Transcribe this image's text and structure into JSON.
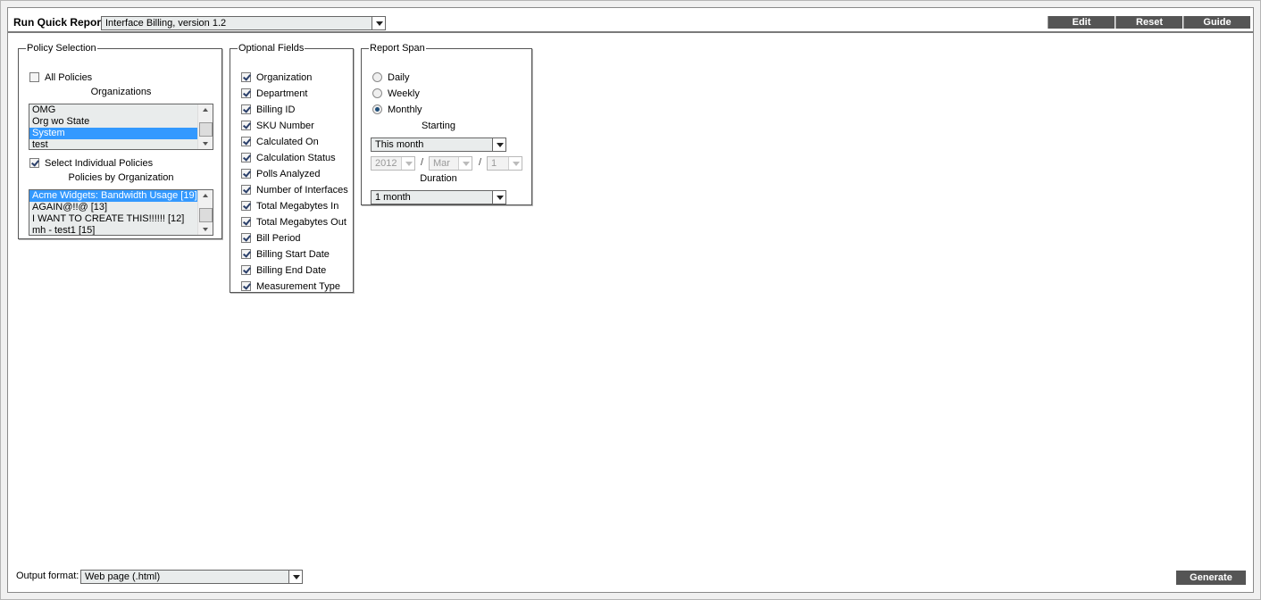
{
  "header": {
    "title": "Run Quick Report",
    "report_select": "Interface Billing, version 1.2",
    "buttons": {
      "edit": "Edit",
      "reset": "Reset",
      "guide": "Guide"
    }
  },
  "policy_selection": {
    "legend": "Policy Selection",
    "all_policies": {
      "label": "All Policies",
      "checked": false
    },
    "organizations_heading": "Organizations",
    "organizations": [
      {
        "label": "OMG",
        "selected": false
      },
      {
        "label": "Org wo State",
        "selected": false
      },
      {
        "label": "System",
        "selected": true
      },
      {
        "label": "test",
        "selected": false
      }
    ],
    "select_individual": {
      "label": "Select Individual Policies",
      "checked": true
    },
    "policies_heading": "Policies by Organization",
    "policies": [
      {
        "label": "Acme Widgets: Bandwidth Usage [19]",
        "selected": true
      },
      {
        "label": "AGAIN@!!@ [13]",
        "selected": false
      },
      {
        "label": "I WANT TO CREATE THIS!!!!!! [12]",
        "selected": false
      },
      {
        "label": "mh - test1 [15]",
        "selected": false
      }
    ]
  },
  "optional_fields": {
    "legend": "Optional Fields",
    "items": [
      {
        "label": "Organization",
        "checked": true
      },
      {
        "label": "Department",
        "checked": true
      },
      {
        "label": "Billing ID",
        "checked": true
      },
      {
        "label": "SKU Number",
        "checked": true
      },
      {
        "label": "Calculated On",
        "checked": true
      },
      {
        "label": "Calculation Status",
        "checked": true
      },
      {
        "label": "Polls Analyzed",
        "checked": true
      },
      {
        "label": "Number of Interfaces",
        "checked": true
      },
      {
        "label": "Total Megabytes In",
        "checked": true
      },
      {
        "label": "Total Megabytes Out",
        "checked": true
      },
      {
        "label": "Bill Period",
        "checked": true
      },
      {
        "label": "Billing Start Date",
        "checked": true
      },
      {
        "label": "Billing End Date",
        "checked": true
      },
      {
        "label": "Measurement Type",
        "checked": true
      }
    ]
  },
  "report_span": {
    "legend": "Report Span",
    "options": [
      {
        "label": "Daily",
        "checked": false
      },
      {
        "label": "Weekly",
        "checked": false
      },
      {
        "label": "Monthly",
        "checked": true
      }
    ],
    "starting_label": "Starting",
    "starting_select": "This month",
    "year": "2012",
    "month": "Mar",
    "day": "1",
    "date_separator": "/",
    "duration_label": "Duration",
    "duration_select": "1 month"
  },
  "footer": {
    "output_format_label": "Output format:",
    "output_format_select": "Web page (.html)",
    "generate_label": "Generate"
  }
}
